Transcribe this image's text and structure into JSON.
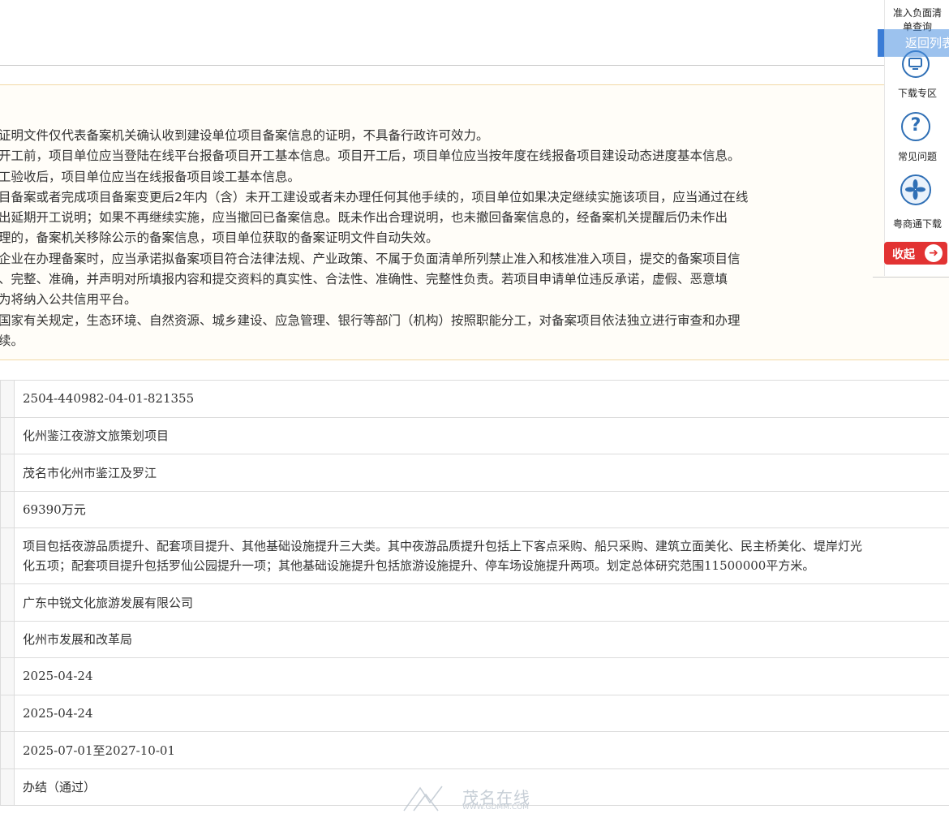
{
  "notice": {
    "lines": [
      "证明文件仅代表备案机关确认收到建设单位项目备案信息的证明，不具备行政许可效力。",
      "开工前，项目单位应当登陆在线平台报备项目开工基本信息。项目开工后，项目单位应当按年度在线报备项目建设动态进度基本信息。",
      "工验收后，项目单位应当在线报备项目竣工基本信息。",
      "目备案或者完成项目备案变更后2年内（含）未开工建设或者未办理任何其他手续的，项目单位如果决定继续实施该项目，应当通过在线",
      "出延期开工说明；如果不再继续实施，应当撤回已备案信息。既未作出合理说明，也未撤回备案信息的，经备案机关提醒后仍未作出",
      "理的，备案机关移除公示的备案信息，项目单位获取的备案证明文件自动失效。",
      "企业在办理备案时，应当承诺拟备案项目符合法律法规、产业政策、不属于负面清单所列禁止准入和核准准入项目，提交的备案项目信",
      "、完整、准确，并声明对所填报内容和提交资料的真实性、合法性、准确性、完整性负责。若项目申请单位违反承诺，虚假、恶意填",
      "为将纳入公共信用平台。",
      "国家有关规定，生态环境、自然资源、城乡建设、应急管理、银行等部门（机构）按照职能分工，对备案项目依法独立进行审查和办理",
      "续。"
    ]
  },
  "project": {
    "code": "2504-440982-04-01-821355",
    "name": "化州鉴江夜游文旅策划项目",
    "location": "茂名市化州市鉴江及罗江",
    "investment": "69390万元",
    "content_line1": "项目包括夜游品质提升、配套项目提升、其他基础设施提升三大类。其中夜游品质提升包括上下客点采购、船只采购、建筑立面美化、民主桥美化、堤岸灯光",
    "content_line2": "化五项；配套项目提升包括罗仙公园提升一项；其他基础设施提升包括旅游设施提升、停车场设施提升两项。划定总体研究范围11500000平方米。",
    "company": "广东中锐文化旅游发展有限公司",
    "authority": "化州市发展和改革局",
    "date1": "2025-04-24",
    "date2": "2025-04-24",
    "period": "2025-07-01至2027-10-01",
    "status": "办结（通过）"
  },
  "sidebar": {
    "negative_list": "准入负面清单查询",
    "return_list": "返回列表",
    "download": "下载专区",
    "faq": "常见问题",
    "yst_download": "粤商通下载",
    "collapse": "收起"
  },
  "watermark": {
    "text": "茂名在线",
    "url": "WWW.GDMM.COM"
  },
  "colors": {
    "accent_blue": "#2f6fb5",
    "collapse_red": "#e23333",
    "notice_border": "#f2d9a6"
  }
}
